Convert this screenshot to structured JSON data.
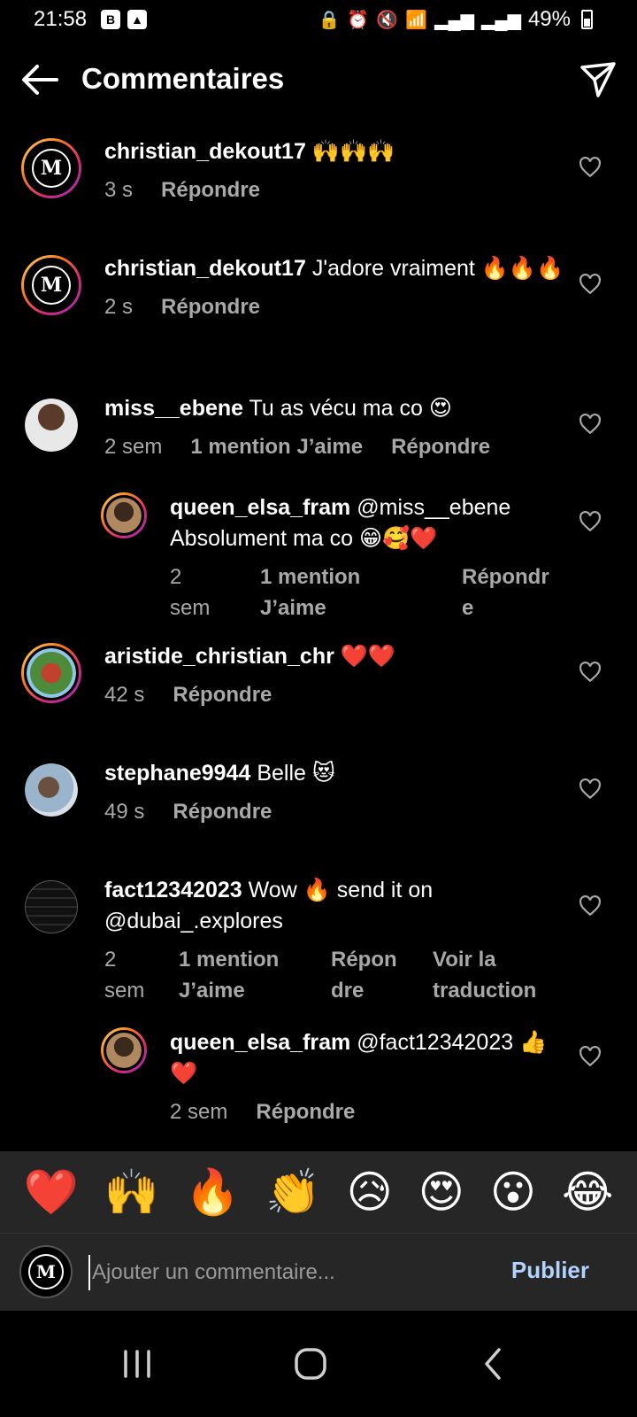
{
  "status_bar": {
    "time": "21:58",
    "left_icons": [
      "b-app-icon",
      "image-icon"
    ],
    "right_icons": [
      "lock-icon",
      "alarm-icon",
      "mute-icon",
      "wifi-icon",
      "signal-icon",
      "signal-icon"
    ],
    "battery": "49%"
  },
  "header": {
    "title": "Commentaires"
  },
  "comments": [
    {
      "user": "christian_dekout17",
      "text": "🙌🙌🙌",
      "time": "3 s",
      "reply": "Répondre"
    },
    {
      "user": "christian_dekout17",
      "text": "J'adore vraiment 🔥🔥🔥",
      "time": "2 s",
      "reply": "Répondre"
    },
    {
      "user": "miss__ebene",
      "text": "Tu as vécu ma co 😍",
      "time": "2 sem",
      "likes": "1 mention J’aime",
      "reply": "Répondre"
    },
    {
      "user": "queen_elsa_fram",
      "text": "@miss__ebene Absolument ma co 😁🥰❤️",
      "time": "2\nsem",
      "likes": "1 mention\nJ’aime",
      "reply": "Répondr\ne"
    },
    {
      "user": "aristide_christian_chr",
      "text": "❤️❤️",
      "time": "42 s",
      "reply": "Répondre"
    },
    {
      "user": "stephane9944",
      "text": "Belle 😻",
      "time": "49 s",
      "reply": "Répondre"
    },
    {
      "user": "fact12342023",
      "text": "Wow 🔥 send it on @dubai_.explores",
      "time": "2\nsem",
      "likes": "1 mention\nJ’aime",
      "reply": "Répon\ndre",
      "translate": "Voir la\ntraduction"
    },
    {
      "user": "queen_elsa_fram",
      "text": "@fact12342023 👍❤️",
      "time": "2 sem",
      "reply": "Répondre"
    }
  ],
  "emoji_bar": [
    "❤️",
    "🙌",
    "🔥",
    "👏",
    "😥",
    "😍",
    "😮",
    "😂"
  ],
  "composer": {
    "placeholder": "Ajouter un commentaire...",
    "publish": "Publier"
  },
  "colors": {
    "background": "#000000",
    "panel": "#262626",
    "secondary_text": "#a8a8a8",
    "publish": "#b3d3ff"
  }
}
